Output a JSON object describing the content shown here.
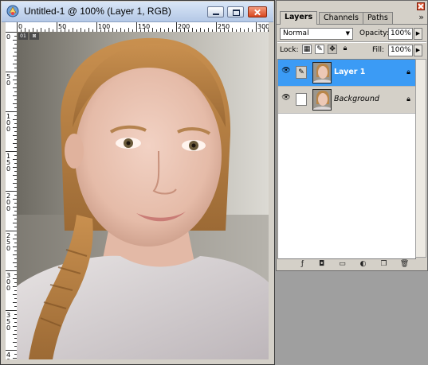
{
  "document_window": {
    "title": "Untitled-1 @ 100% (Layer 1, RGB)",
    "controls": {
      "minimize": "minimize-icon",
      "maximize": "maximize-icon",
      "close": "close-icon"
    },
    "rulers": {
      "top_labels": [
        "0",
        "50",
        "100",
        "150",
        "200",
        "250",
        "300"
      ],
      "left_labels": [
        "0",
        "5",
        "1",
        "1",
        "2",
        "2",
        "3",
        "3",
        "4"
      ],
      "left_labels_2": [
        "",
        "0",
        "0",
        "5",
        "0",
        "5",
        "0",
        "5",
        "0"
      ],
      "left_labels_3": [
        "",
        "",
        "0",
        "0",
        "0",
        "0",
        "0",
        "0",
        "0"
      ]
    },
    "guide_markers": [
      "01",
      "⊠"
    ],
    "canvas": {
      "description_icon": "portrait-photo"
    }
  },
  "layers_palette": {
    "tabs": [
      {
        "label": "Layers",
        "active": true
      },
      {
        "label": "Channels",
        "active": false
      },
      {
        "label": "Paths",
        "active": false
      }
    ],
    "menu_icon": "»",
    "blend_mode": "Normal",
    "opacity_label": "Opacity:",
    "opacity_value": "100%",
    "lock_label": "Lock:",
    "fill_label": "Fill:",
    "fill_value": "100%",
    "layers": [
      {
        "name": "Layer 1",
        "selected": true,
        "visible": true
      },
      {
        "name": "Background",
        "selected": false,
        "visible": true
      }
    ],
    "bottom_icons": [
      "layer-style-icon",
      "layer-mask-icon",
      "new-set-icon",
      "adjustment-layer-icon",
      "new-layer-icon",
      "trash-icon"
    ]
  },
  "colors": {
    "selection_blue": "#3b9bf5",
    "panel_gray": "#d4d0c8",
    "close_red": "#d8461f"
  }
}
